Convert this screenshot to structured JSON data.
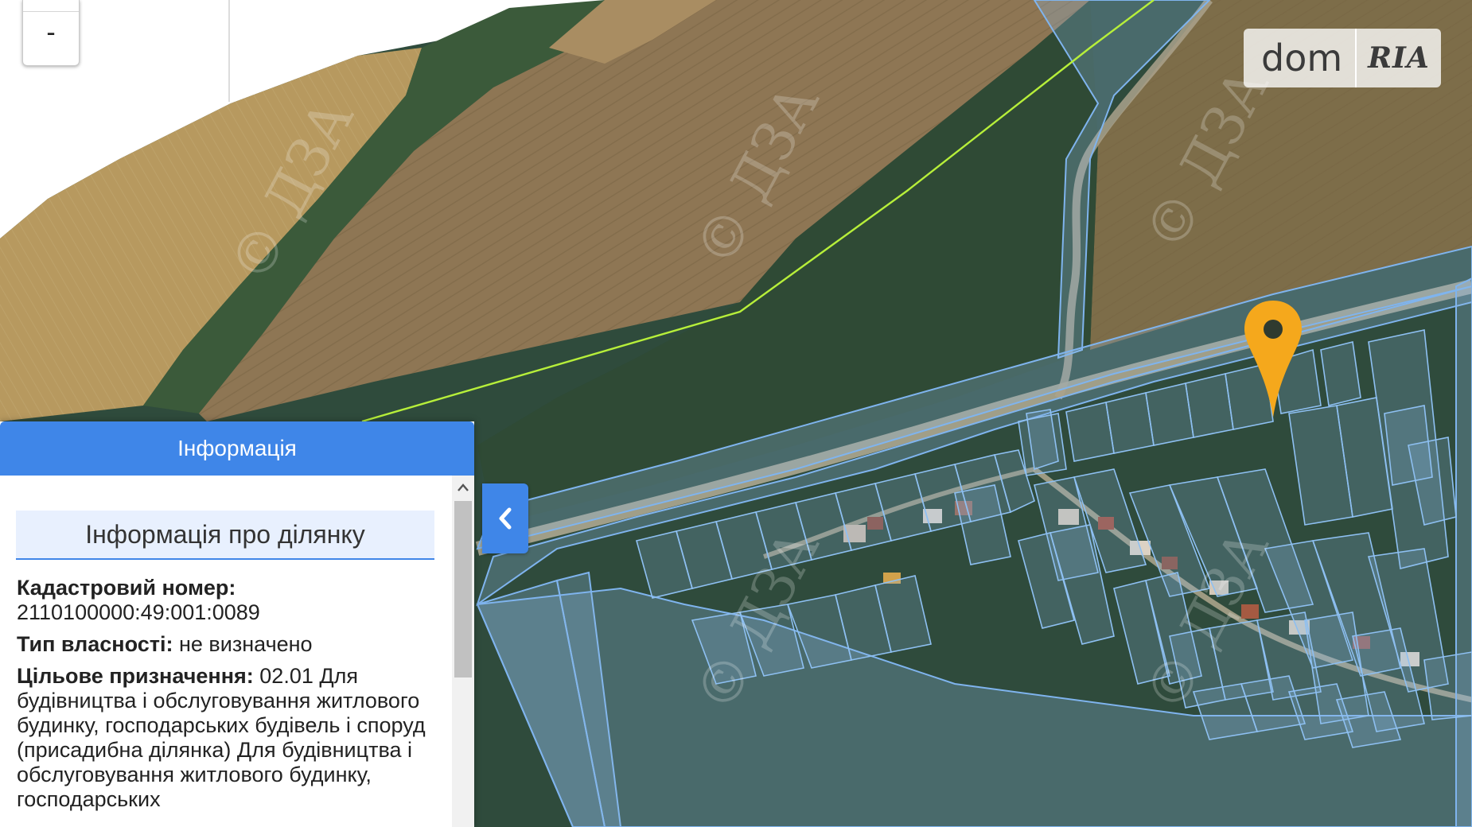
{
  "map": {
    "zoom_out_label": "-",
    "watermark_text": "© ДЗА",
    "colors": {
      "field": "#9a8158",
      "field_dark": "#7d6a45",
      "forest": "#34503e",
      "road": "#b5b09c",
      "parcel_fill": "#8fb9e6",
      "parcel_stroke": "#7fb4ee",
      "boundary_line": "#b7ef3a",
      "marker": "#f5a81c"
    },
    "icons": {
      "marker": "map-pin-icon",
      "collapse": "chevron-left-icon"
    }
  },
  "brand": {
    "left": "dom",
    "right": "RIA"
  },
  "panel": {
    "header": "Інформація",
    "section_title": "Інформація про ділянку",
    "fields": {
      "cadastral_label": "Кадастровий номер:",
      "cadastral_value": "2110100000:49:001:0089",
      "ownership_label": "Тип власності:",
      "ownership_value": "не визначено",
      "purpose_label": "Цільове призначення:",
      "purpose_value": "02.01 Для будівництва і обслуговування житлового будинку, господарських будівель і споруд (присадибна ділянка) Для будівництва і обслуговування житлового будинку, господарських"
    }
  }
}
